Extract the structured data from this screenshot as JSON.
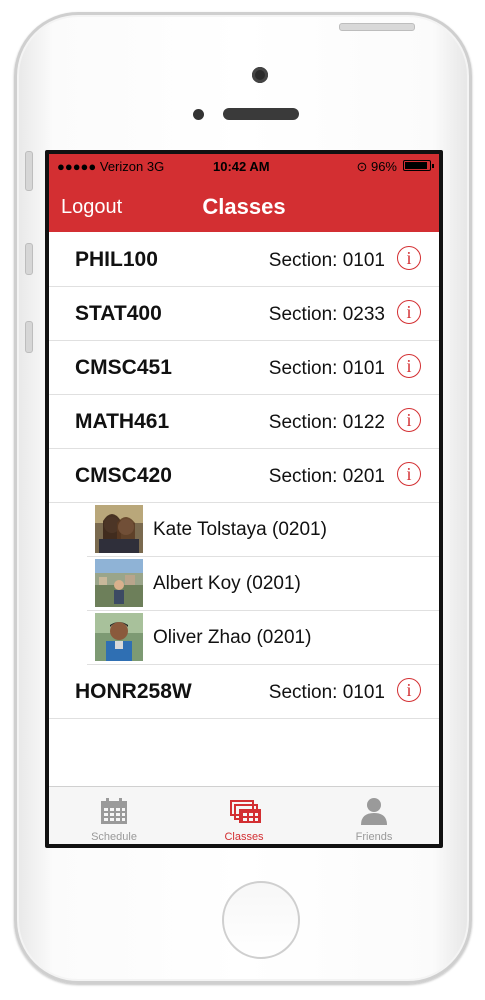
{
  "status_bar": {
    "carrier": "●●●●● Verizon  3G",
    "time": "10:42 AM",
    "right": "⊙ 96%",
    "battery_level": 0.96
  },
  "header": {
    "logout_label": "Logout",
    "title": "Classes"
  },
  "classes": [
    {
      "code": "PHIL100",
      "section": "Section: 0101"
    },
    {
      "code": "STAT400",
      "section": "Section: 0233"
    },
    {
      "code": "CMSC451",
      "section": "Section: 0101"
    },
    {
      "code": "MATH461",
      "section": "Section: 0122"
    },
    {
      "code": "CMSC420",
      "section": "Section: 0201"
    },
    {
      "code": "HONR258W",
      "section": "Section: 0101"
    }
  ],
  "friends": [
    {
      "name": "Kate Tolstaya (0201)",
      "avatar": "avatar-photo"
    },
    {
      "name": "Albert Koy (0201)",
      "avatar": "avatar-photo"
    },
    {
      "name": "Oliver Zhao (0201)",
      "avatar": "avatar-photo"
    }
  ],
  "info_icon": "info-icon",
  "tabs": [
    {
      "label": "Schedule",
      "icon": "calendar-icon"
    },
    {
      "label": "Classes",
      "icon": "classes-icon"
    },
    {
      "label": "Friends",
      "icon": "person-icon"
    }
  ],
  "colors": {
    "accent": "#d32f32",
    "inactive": "#999999"
  }
}
